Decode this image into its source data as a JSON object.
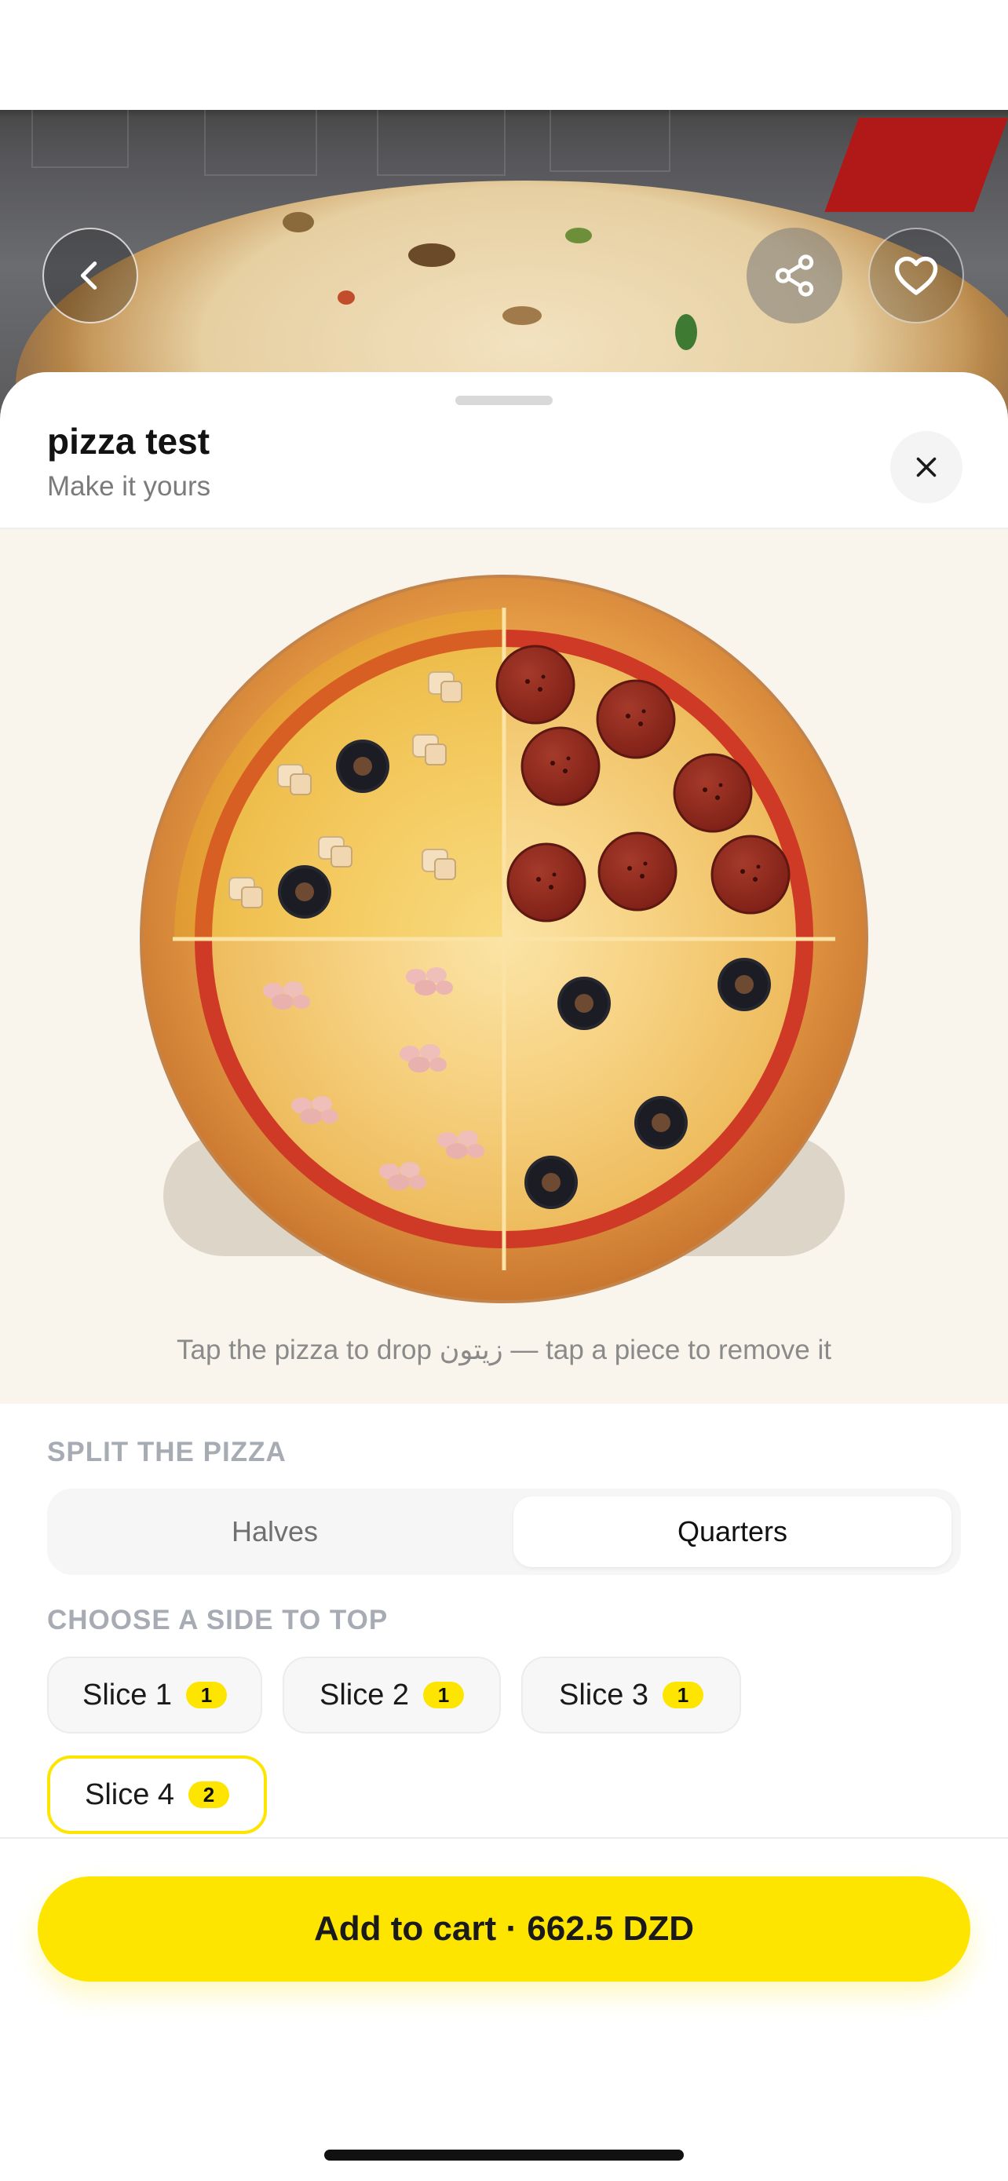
{
  "header": {
    "back_icon": "chevron-left-icon",
    "share_icon": "share-icon",
    "favorite_icon": "heart-icon"
  },
  "sheet": {
    "title": "pizza test",
    "subtitle": "Make it yours",
    "close_icon": "close-icon"
  },
  "pizza": {
    "hint": "Tap the pizza to drop زيتون — tap a piece to remove it",
    "quarters": [
      {
        "id": "top-left",
        "topping": "mushroom-and-olive"
      },
      {
        "id": "top-right",
        "topping": "pepperoni"
      },
      {
        "id": "bottom-left",
        "topping": "ham"
      },
      {
        "id": "bottom-right",
        "topping": "olive"
      }
    ]
  },
  "split": {
    "label": "SPLIT THE PIZZA",
    "options": [
      "Halves",
      "Quarters"
    ],
    "selected": "Quarters"
  },
  "sides": {
    "label": "CHOOSE A SIDE TO TOP",
    "chips": [
      {
        "label": "Slice 1",
        "count": "1"
      },
      {
        "label": "Slice 2",
        "count": "1"
      },
      {
        "label": "Slice 3",
        "count": "1"
      },
      {
        "label": "Slice 4",
        "count": "2"
      }
    ],
    "selected": "Slice 4"
  },
  "cart": {
    "label": "Add to cart · 662.5 DZD"
  },
  "colors": {
    "accent": "#FDE500",
    "sheet_background": "#FAF5EC"
  }
}
